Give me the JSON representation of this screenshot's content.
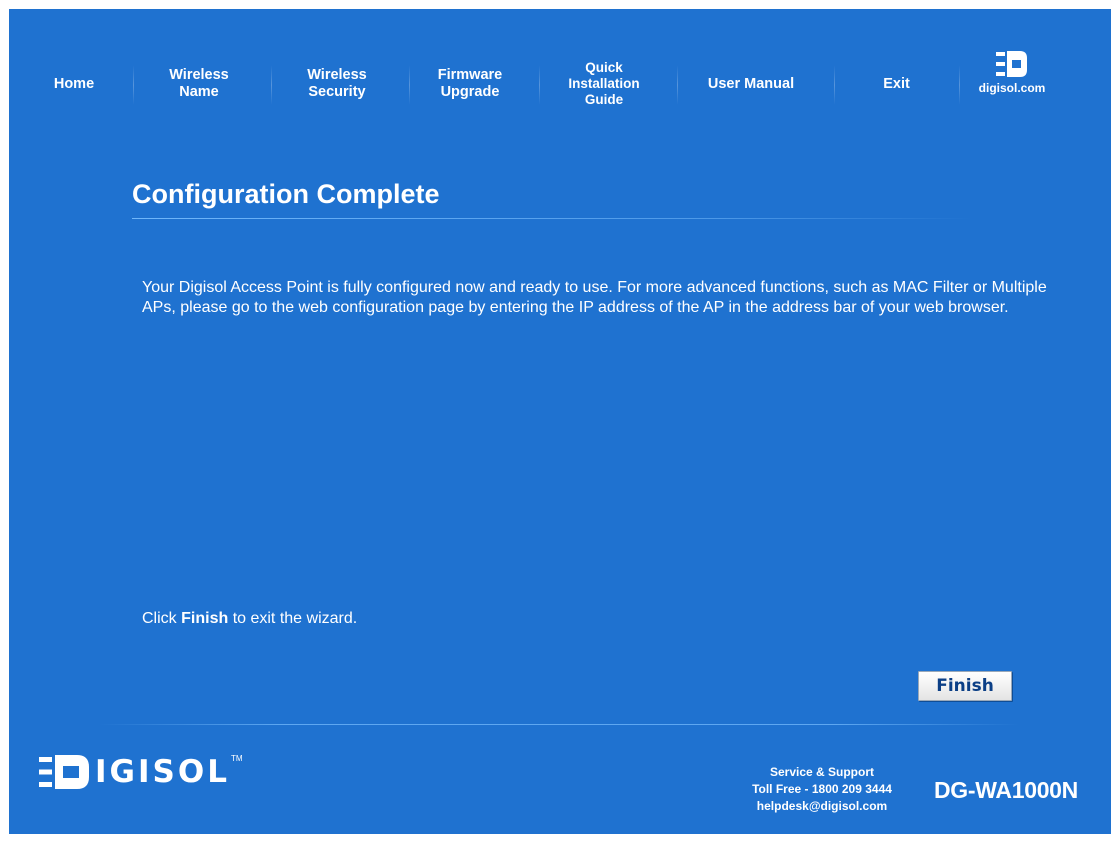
{
  "nav": {
    "items": [
      {
        "lines": [
          "Home"
        ]
      },
      {
        "lines": [
          "Wireless",
          "Name"
        ]
      },
      {
        "lines": [
          "Wireless",
          "Security"
        ]
      },
      {
        "lines": [
          "Firmware",
          "Upgrade"
        ]
      },
      {
        "lines": [
          "Quick",
          "Installation",
          "Guide"
        ]
      },
      {
        "lines": [
          "User Manual"
        ]
      },
      {
        "lines": [
          "Exit"
        ]
      }
    ],
    "brand_site": "digisol.com"
  },
  "main": {
    "title": "Configuration Complete",
    "body": "Your Digisol Access Point is fully configured now and ready to use. For more advanced functions, such as MAC Filter or Multiple APs, please go to the web configuration page by entering the IP address of the AP in the address bar of your web browser.",
    "hint_before": "Click",
    "hint_bold": "Finish",
    "hint_after": "to exit the wizard.",
    "finish_label": "Finish"
  },
  "footer": {
    "logo_text": "IGISOL",
    "logo_tm": "TM",
    "support_title": "Service & Support",
    "toll_free": "Toll Free - 1800 209 3444",
    "email": "helpdesk@digisol.com",
    "model": "DG-WA1000N"
  },
  "colors": {
    "background": "#1f72d0",
    "text": "#ffffff",
    "button_text": "#0c3f86"
  }
}
